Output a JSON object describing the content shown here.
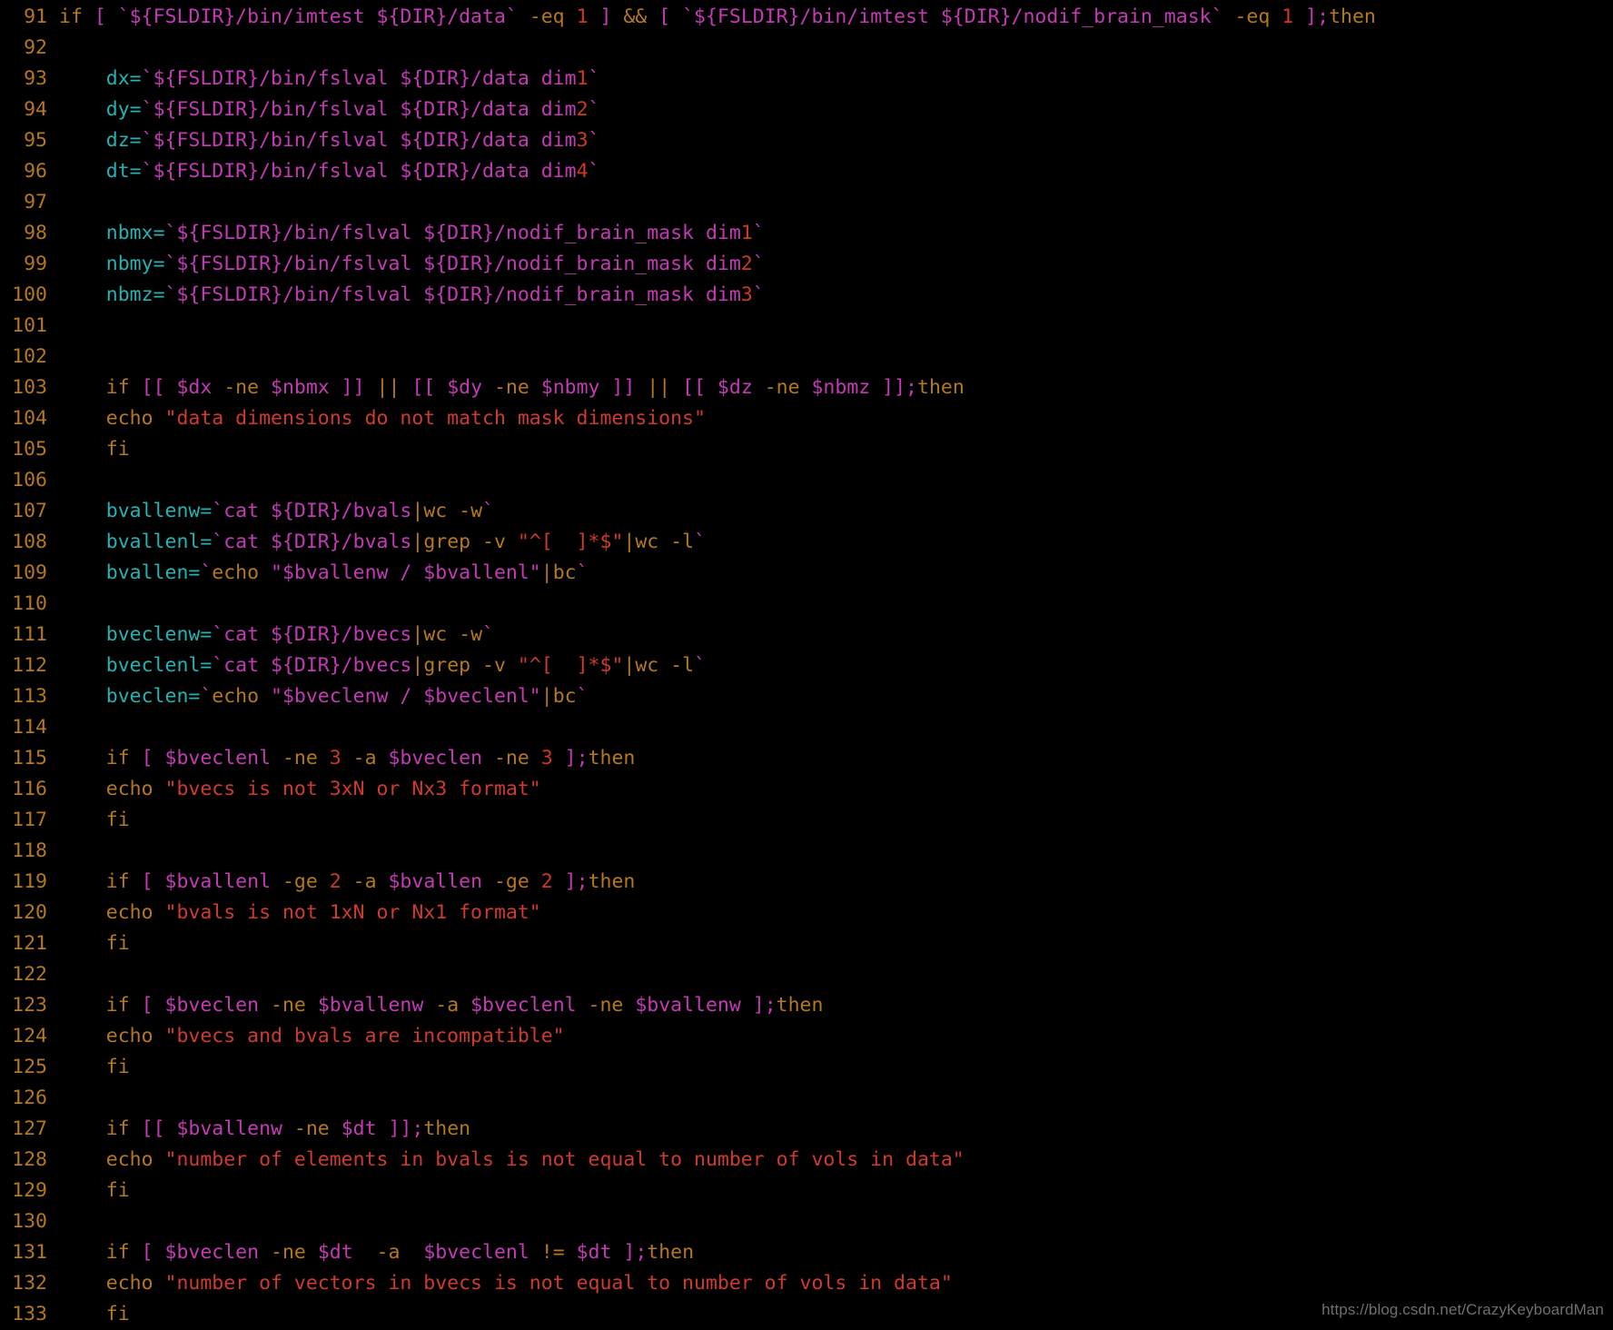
{
  "editor": {
    "background_color": "#000000",
    "language": "shell",
    "first_line_number": 91,
    "last_line_number": 133
  },
  "palette": {
    "line_number": "#b5781e",
    "keyword": "#b5781e",
    "path_variable": "#c43ab5",
    "assignment_variable": "#24b2b2",
    "number": "#cf3a1f",
    "string": "#cf3a2f",
    "background": "#000000",
    "watermark": "#6e6e6e"
  },
  "watermark": {
    "text": "https://blog.csdn.net/CrazyKeyboardMan"
  },
  "lines": [
    {
      "number": "91",
      "tokens": [
        {
          "t": "if ",
          "c": "kw"
        },
        {
          "t": "[ ",
          "c": "path"
        },
        {
          "t": "`${FSLDIR}/bin/imtest ${DIR}/data`",
          "c": "path"
        },
        {
          "t": " -eq ",
          "c": "kw"
        },
        {
          "t": "1",
          "c": "num"
        },
        {
          "t": " ]",
          "c": "path"
        },
        {
          "t": " && ",
          "c": "kw"
        },
        {
          "t": "[ ",
          "c": "path"
        },
        {
          "t": "`${FSLDIR}/bin/imtest ${DIR}/nodif_brain_mask`",
          "c": "path"
        },
        {
          "t": " -eq ",
          "c": "kw"
        },
        {
          "t": "1",
          "c": "num"
        },
        {
          "t": " ]",
          "c": "path"
        },
        {
          "t": ";",
          "c": "path"
        },
        {
          "t": "then",
          "c": "kw"
        }
      ]
    },
    {
      "number": "92",
      "tokens": []
    },
    {
      "number": "93",
      "tokens": [
        {
          "t": "    ",
          "c": "plain"
        },
        {
          "t": "dx",
          "c": "var"
        },
        {
          "t": "=",
          "c": "var"
        },
        {
          "t": "`${FSLDIR}/bin/fslval ${DIR}/data dim",
          "c": "path"
        },
        {
          "t": "1",
          "c": "num"
        },
        {
          "t": "`",
          "c": "path"
        }
      ]
    },
    {
      "number": "94",
      "tokens": [
        {
          "t": "    ",
          "c": "plain"
        },
        {
          "t": "dy",
          "c": "var"
        },
        {
          "t": "=",
          "c": "var"
        },
        {
          "t": "`${FSLDIR}/bin/fslval ${DIR}/data dim",
          "c": "path"
        },
        {
          "t": "2",
          "c": "num"
        },
        {
          "t": "`",
          "c": "path"
        }
      ]
    },
    {
      "number": "95",
      "tokens": [
        {
          "t": "    ",
          "c": "plain"
        },
        {
          "t": "dz",
          "c": "var"
        },
        {
          "t": "=",
          "c": "var"
        },
        {
          "t": "`${FSLDIR}/bin/fslval ${DIR}/data dim",
          "c": "path"
        },
        {
          "t": "3",
          "c": "num"
        },
        {
          "t": "`",
          "c": "path"
        }
      ]
    },
    {
      "number": "96",
      "tokens": [
        {
          "t": "    ",
          "c": "plain"
        },
        {
          "t": "dt",
          "c": "var"
        },
        {
          "t": "=",
          "c": "var"
        },
        {
          "t": "`${FSLDIR}/bin/fslval ${DIR}/data dim",
          "c": "path"
        },
        {
          "t": "4",
          "c": "num"
        },
        {
          "t": "`",
          "c": "path"
        }
      ]
    },
    {
      "number": "97",
      "tokens": []
    },
    {
      "number": "98",
      "tokens": [
        {
          "t": "    ",
          "c": "plain"
        },
        {
          "t": "nbmx",
          "c": "var"
        },
        {
          "t": "=",
          "c": "var"
        },
        {
          "t": "`${FSLDIR}/bin/fslval ${DIR}/nodif_brain_mask dim",
          "c": "path"
        },
        {
          "t": "1",
          "c": "num"
        },
        {
          "t": "`",
          "c": "path"
        }
      ]
    },
    {
      "number": "99",
      "tokens": [
        {
          "t": "    ",
          "c": "plain"
        },
        {
          "t": "nbmy",
          "c": "var"
        },
        {
          "t": "=",
          "c": "var"
        },
        {
          "t": "`${FSLDIR}/bin/fslval ${DIR}/nodif_brain_mask dim",
          "c": "path"
        },
        {
          "t": "2",
          "c": "num"
        },
        {
          "t": "`",
          "c": "path"
        }
      ]
    },
    {
      "number": "100",
      "tokens": [
        {
          "t": "    ",
          "c": "plain"
        },
        {
          "t": "nbmz",
          "c": "var"
        },
        {
          "t": "=",
          "c": "var"
        },
        {
          "t": "`${FSLDIR}/bin/fslval ${DIR}/nodif_brain_mask dim",
          "c": "path"
        },
        {
          "t": "3",
          "c": "num"
        },
        {
          "t": "`",
          "c": "path"
        }
      ]
    },
    {
      "number": "101",
      "tokens": []
    },
    {
      "number": "102",
      "tokens": []
    },
    {
      "number": "103",
      "tokens": [
        {
          "t": "    ",
          "c": "plain"
        },
        {
          "t": "if ",
          "c": "kw"
        },
        {
          "t": "[[ $dx ",
          "c": "path"
        },
        {
          "t": "-ne",
          "c": "kw"
        },
        {
          "t": " $nbmx ]]",
          "c": "path"
        },
        {
          "t": " || ",
          "c": "kw"
        },
        {
          "t": "[[ $dy ",
          "c": "path"
        },
        {
          "t": "-ne",
          "c": "kw"
        },
        {
          "t": " $nbmy ]]",
          "c": "path"
        },
        {
          "t": " || ",
          "c": "kw"
        },
        {
          "t": "[[ $dz ",
          "c": "path"
        },
        {
          "t": "-ne",
          "c": "kw"
        },
        {
          "t": " $nbmz ]]",
          "c": "path"
        },
        {
          "t": ";",
          "c": "path"
        },
        {
          "t": "then",
          "c": "kw"
        }
      ]
    },
    {
      "number": "104",
      "tokens": [
        {
          "t": "    ",
          "c": "plain"
        },
        {
          "t": "echo ",
          "c": "kw"
        },
        {
          "t": "\"data dimensions do not match mask dimensions\"",
          "c": "str"
        }
      ]
    },
    {
      "number": "105",
      "tokens": [
        {
          "t": "    ",
          "c": "plain"
        },
        {
          "t": "fi",
          "c": "kw"
        }
      ]
    },
    {
      "number": "106",
      "tokens": []
    },
    {
      "number": "107",
      "tokens": [
        {
          "t": "    ",
          "c": "plain"
        },
        {
          "t": "bvallenw",
          "c": "var"
        },
        {
          "t": "=",
          "c": "var"
        },
        {
          "t": "`cat ${DIR}/bvals",
          "c": "path"
        },
        {
          "t": "|",
          "c": "kw"
        },
        {
          "t": "wc -w",
          "c": "kw"
        },
        {
          "t": "`",
          "c": "path"
        }
      ]
    },
    {
      "number": "108",
      "tokens": [
        {
          "t": "    ",
          "c": "plain"
        },
        {
          "t": "bvallenl",
          "c": "var"
        },
        {
          "t": "=",
          "c": "var"
        },
        {
          "t": "`cat ${DIR}/bvals",
          "c": "path"
        },
        {
          "t": "|",
          "c": "kw"
        },
        {
          "t": "grep -v ",
          "c": "kw"
        },
        {
          "t": "\"^[  ]*$\"",
          "c": "str"
        },
        {
          "t": "|",
          "c": "kw"
        },
        {
          "t": "wc -l",
          "c": "kw"
        },
        {
          "t": "`",
          "c": "path"
        }
      ]
    },
    {
      "number": "109",
      "tokens": [
        {
          "t": "    ",
          "c": "plain"
        },
        {
          "t": "bvallen",
          "c": "var"
        },
        {
          "t": "=",
          "c": "var"
        },
        {
          "t": "`",
          "c": "path"
        },
        {
          "t": "echo ",
          "c": "kw"
        },
        {
          "t": "\"$bvallenw / $bvallenl\"",
          "c": "path"
        },
        {
          "t": "|",
          "c": "kw"
        },
        {
          "t": "bc",
          "c": "kw"
        },
        {
          "t": "`",
          "c": "path"
        }
      ]
    },
    {
      "number": "110",
      "tokens": []
    },
    {
      "number": "111",
      "tokens": [
        {
          "t": "    ",
          "c": "plain"
        },
        {
          "t": "bveclenw",
          "c": "var"
        },
        {
          "t": "=",
          "c": "var"
        },
        {
          "t": "`cat ${DIR}/bvecs",
          "c": "path"
        },
        {
          "t": "|",
          "c": "kw"
        },
        {
          "t": "wc -w",
          "c": "kw"
        },
        {
          "t": "`",
          "c": "path"
        }
      ]
    },
    {
      "number": "112",
      "tokens": [
        {
          "t": "    ",
          "c": "plain"
        },
        {
          "t": "bveclenl",
          "c": "var"
        },
        {
          "t": "=",
          "c": "var"
        },
        {
          "t": "`cat ${DIR}/bvecs",
          "c": "path"
        },
        {
          "t": "|",
          "c": "kw"
        },
        {
          "t": "grep -v ",
          "c": "kw"
        },
        {
          "t": "\"^[  ]*$\"",
          "c": "str"
        },
        {
          "t": "|",
          "c": "kw"
        },
        {
          "t": "wc -l",
          "c": "kw"
        },
        {
          "t": "`",
          "c": "path"
        }
      ]
    },
    {
      "number": "113",
      "tokens": [
        {
          "t": "    ",
          "c": "plain"
        },
        {
          "t": "bveclen",
          "c": "var"
        },
        {
          "t": "=",
          "c": "var"
        },
        {
          "t": "`",
          "c": "path"
        },
        {
          "t": "echo ",
          "c": "kw"
        },
        {
          "t": "\"$bveclenw / $bveclenl\"",
          "c": "path"
        },
        {
          "t": "|",
          "c": "kw"
        },
        {
          "t": "bc",
          "c": "kw"
        },
        {
          "t": "`",
          "c": "path"
        }
      ]
    },
    {
      "number": "114",
      "tokens": []
    },
    {
      "number": "115",
      "tokens": [
        {
          "t": "    ",
          "c": "plain"
        },
        {
          "t": "if ",
          "c": "kw"
        },
        {
          "t": "[ ",
          "c": "path"
        },
        {
          "t": "$bveclenl",
          "c": "path"
        },
        {
          "t": " -ne ",
          "c": "kw"
        },
        {
          "t": "3",
          "c": "num"
        },
        {
          "t": " -a ",
          "c": "kw"
        },
        {
          "t": "$bveclen",
          "c": "path"
        },
        {
          "t": " -ne ",
          "c": "kw"
        },
        {
          "t": "3",
          "c": "num"
        },
        {
          "t": " ]",
          "c": "path"
        },
        {
          "t": ";",
          "c": "path"
        },
        {
          "t": "then",
          "c": "kw"
        }
      ]
    },
    {
      "number": "116",
      "tokens": [
        {
          "t": "    ",
          "c": "plain"
        },
        {
          "t": "echo ",
          "c": "kw"
        },
        {
          "t": "\"bvecs is not 3xN or Nx3 format\"",
          "c": "str"
        }
      ]
    },
    {
      "number": "117",
      "tokens": [
        {
          "t": "    ",
          "c": "plain"
        },
        {
          "t": "fi",
          "c": "kw"
        }
      ]
    },
    {
      "number": "118",
      "tokens": []
    },
    {
      "number": "119",
      "tokens": [
        {
          "t": "    ",
          "c": "plain"
        },
        {
          "t": "if ",
          "c": "kw"
        },
        {
          "t": "[ ",
          "c": "path"
        },
        {
          "t": "$bvallenl",
          "c": "path"
        },
        {
          "t": " -ge ",
          "c": "kw"
        },
        {
          "t": "2",
          "c": "num"
        },
        {
          "t": " -a ",
          "c": "kw"
        },
        {
          "t": "$bvallen",
          "c": "path"
        },
        {
          "t": " -ge ",
          "c": "kw"
        },
        {
          "t": "2",
          "c": "num"
        },
        {
          "t": " ]",
          "c": "path"
        },
        {
          "t": ";",
          "c": "path"
        },
        {
          "t": "then",
          "c": "kw"
        }
      ]
    },
    {
      "number": "120",
      "tokens": [
        {
          "t": "    ",
          "c": "plain"
        },
        {
          "t": "echo ",
          "c": "kw"
        },
        {
          "t": "\"bvals is not 1xN or Nx1 format\"",
          "c": "str"
        }
      ]
    },
    {
      "number": "121",
      "tokens": [
        {
          "t": "    ",
          "c": "plain"
        },
        {
          "t": "fi",
          "c": "kw"
        }
      ]
    },
    {
      "number": "122",
      "tokens": []
    },
    {
      "number": "123",
      "tokens": [
        {
          "t": "    ",
          "c": "plain"
        },
        {
          "t": "if ",
          "c": "kw"
        },
        {
          "t": "[ ",
          "c": "path"
        },
        {
          "t": "$bveclen",
          "c": "path"
        },
        {
          "t": " -ne ",
          "c": "kw"
        },
        {
          "t": "$bvallenw",
          "c": "path"
        },
        {
          "t": " -a ",
          "c": "kw"
        },
        {
          "t": "$bveclenl",
          "c": "path"
        },
        {
          "t": " -ne ",
          "c": "kw"
        },
        {
          "t": "$bvallenw",
          "c": "path"
        },
        {
          "t": " ]",
          "c": "path"
        },
        {
          "t": ";",
          "c": "path"
        },
        {
          "t": "then",
          "c": "kw"
        }
      ]
    },
    {
      "number": "124",
      "tokens": [
        {
          "t": "    ",
          "c": "plain"
        },
        {
          "t": "echo ",
          "c": "kw"
        },
        {
          "t": "\"bvecs and bvals are incompatible\"",
          "c": "str"
        }
      ]
    },
    {
      "number": "125",
      "tokens": [
        {
          "t": "    ",
          "c": "plain"
        },
        {
          "t": "fi",
          "c": "kw"
        }
      ]
    },
    {
      "number": "126",
      "tokens": []
    },
    {
      "number": "127",
      "tokens": [
        {
          "t": "    ",
          "c": "plain"
        },
        {
          "t": "if ",
          "c": "kw"
        },
        {
          "t": "[[ $bvallenw ",
          "c": "path"
        },
        {
          "t": "-ne",
          "c": "kw"
        },
        {
          "t": " $dt ]]",
          "c": "path"
        },
        {
          "t": ";",
          "c": "path"
        },
        {
          "t": "then",
          "c": "kw"
        }
      ]
    },
    {
      "number": "128",
      "tokens": [
        {
          "t": "    ",
          "c": "plain"
        },
        {
          "t": "echo ",
          "c": "kw"
        },
        {
          "t": "\"number of elements in bvals is not equal to number of vols in data\"",
          "c": "str"
        }
      ]
    },
    {
      "number": "129",
      "tokens": [
        {
          "t": "    ",
          "c": "plain"
        },
        {
          "t": "fi",
          "c": "kw"
        }
      ]
    },
    {
      "number": "130",
      "tokens": []
    },
    {
      "number": "131",
      "tokens": [
        {
          "t": "    ",
          "c": "plain"
        },
        {
          "t": "if ",
          "c": "kw"
        },
        {
          "t": "[ ",
          "c": "path"
        },
        {
          "t": "$bveclen",
          "c": "path"
        },
        {
          "t": " -ne ",
          "c": "kw"
        },
        {
          "t": "$dt",
          "c": "path"
        },
        {
          "t": "  -a  ",
          "c": "kw"
        },
        {
          "t": "$bveclenl ",
          "c": "path"
        },
        {
          "t": "!=",
          "c": "kw"
        },
        {
          "t": " $dt",
          "c": "path"
        },
        {
          "t": " ]",
          "c": "path"
        },
        {
          "t": ";",
          "c": "path"
        },
        {
          "t": "then",
          "c": "kw"
        }
      ]
    },
    {
      "number": "132",
      "tokens": [
        {
          "t": "    ",
          "c": "plain"
        },
        {
          "t": "echo ",
          "c": "kw"
        },
        {
          "t": "\"number of vectors in bvecs is not equal to number of vols in data\"",
          "c": "str"
        }
      ]
    },
    {
      "number": "133",
      "tokens": [
        {
          "t": "    ",
          "c": "plain"
        },
        {
          "t": "fi",
          "c": "kw"
        }
      ]
    }
  ]
}
